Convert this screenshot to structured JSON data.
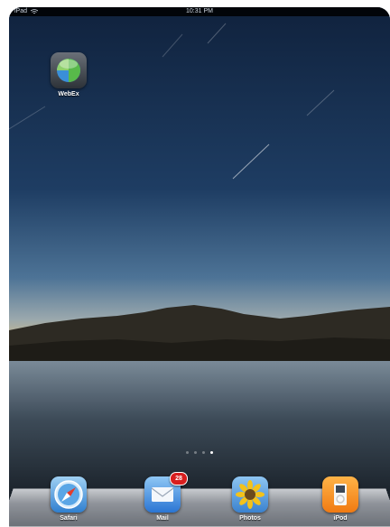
{
  "status_bar": {
    "carrier": "iPad",
    "time": "10:31 PM"
  },
  "home_apps": [
    {
      "label": "WebEx",
      "icon": "webex-icon"
    }
  ],
  "page_indicator": {
    "total": 4,
    "current": 4
  },
  "dock_apps": [
    {
      "label": "Safari",
      "icon": "safari-icon"
    },
    {
      "label": "Mail",
      "icon": "mail-icon",
      "badge": "28"
    },
    {
      "label": "Photos",
      "icon": "photos-icon"
    },
    {
      "label": "iPod",
      "icon": "ipod-icon"
    }
  ]
}
